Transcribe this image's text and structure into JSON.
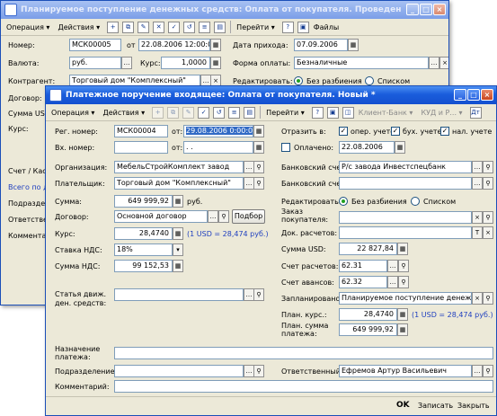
{
  "back_window": {
    "title": "Планируемое поступление денежных средств: Оплата от покупателя. Проведен",
    "toolbar": {
      "operation": "Операция",
      "actions": "Действия",
      "goto": "Перейти",
      "files": "Файлы"
    },
    "fields": {
      "number_label": "Номер:",
      "number": "МСК00005",
      "from_label": "от",
      "date": "22.08.2006 12:00:00",
      "currency_label": "Валюта:",
      "currency": "руб.",
      "rate_label": "Курс:",
      "rate": "1,0000",
      "contractor_label": "Контрагент:",
      "contractor": "Торговый дом \"Комплексный\"",
      "contract_label": "Договор:",
      "amount_usd_label": "Сумма USD:",
      "rate2_label": "Курс:",
      "arrival_date_label": "Дата прихода:",
      "arrival_date": "07.09.2006",
      "payment_form_label": "Форма оплаты:",
      "payment_form": "Безналичные",
      "edit_label": "Редактировать:",
      "no_breakdown": "Без разбиения",
      "by_list": "Списком",
      "account_label": "Счет / Кас",
      "total_label": "Всего по д",
      "division_label": "Подраздел",
      "responsible_label": "Ответствен",
      "comment_label": "Комментар"
    }
  },
  "front_window": {
    "title": "Платежное поручение входящее: Оплата от покупателя. Новый *",
    "toolbar": {
      "operation": "Операция",
      "actions": "Действия",
      "goto": "Перейти",
      "client_bank": "Клиент-Банк",
      "kudir": "КУД и Р..."
    },
    "fields": {
      "reg_number_label": "Рег. номер:",
      "reg_number": "МСК00004",
      "from_label": "от:",
      "reg_date": "29.08.2006 0:00:00",
      "in_number_label": "Вх. номер:",
      "in_from_label": "от:",
      "in_date": " .  .",
      "reflect_label": "Отразить в:",
      "oper_acc": "опер. учете",
      "buh_acc": "бух. учете",
      "tax_acc": "нал. учете",
      "paid_label": "Оплачено:",
      "paid_date": "22.08.2006",
      "org_label": "Организация:",
      "org": "МебельСтройКомплект завод",
      "bank_acc_label": "Банковский счет:",
      "bank_acc": "Р/с завода Инвестспецбанк",
      "payer_label": "Плательщик:",
      "payer": "Торговый дом \"Комплексный\"",
      "payer_bank_acc_label": "Банковский счет:",
      "payer_bank_acc": "",
      "sum_label": "Сумма:",
      "sum": "649 999,92",
      "sum_currency": "руб.",
      "edit_label": "Редактировать:",
      "no_breakdown": "Без разбиения",
      "by_list": "Списком",
      "contract_label": "Договор:",
      "contract": "Основной договор",
      "select_button": "Подбор",
      "order_label": "Заказ покупателя:",
      "order": "",
      "settle_doc_label": "Док. расчетов:",
      "settle_doc": "",
      "rate_label": "Курс:",
      "rate": "28,4740",
      "rate_note": "(1 USD = 28,474 руб.)",
      "sum_usd_label": "Сумма USD:",
      "sum_usd": "22 827,84",
      "vat_rate_label": "Ставка НДС:",
      "vat_rate": "18%",
      "settle_acc_label": "Счет расчетов:",
      "settle_acc": "62.31",
      "vat_sum_label": "Сумма НДС:",
      "vat_sum": "99 152,53",
      "advance_acc_label": "Счет авансов:",
      "advance_acc": "62.32",
      "cash_flow_label": "Статья движ. ден. средств:",
      "cash_flow": "",
      "planned_label": "Запланировано:",
      "planned": "Планируемое поступление денеж",
      "plan_rate_label": "План. курс.:",
      "plan_rate": "28,4740",
      "plan_rate_note": "(1 USD = 28,474 руб.)",
      "plan_sum_label": "План. сумма платежа:",
      "plan_sum": "649 999,92",
      "purpose_label": "Назначение платежа:",
      "purpose": "",
      "division_label": "Подразделение:",
      "division": "",
      "responsible_label": "Ответственный:",
      "responsible": "Ефремов Артур Васильевич",
      "comment_label": "Комментарий:",
      "comment": ""
    },
    "footer": {
      "ok": "OK",
      "save": "Записать",
      "close": "Закрыть"
    }
  },
  "colors": {
    "titlebar": "#1450cf",
    "link_blue": "#1f3fbf",
    "selection": "#316ac5"
  }
}
